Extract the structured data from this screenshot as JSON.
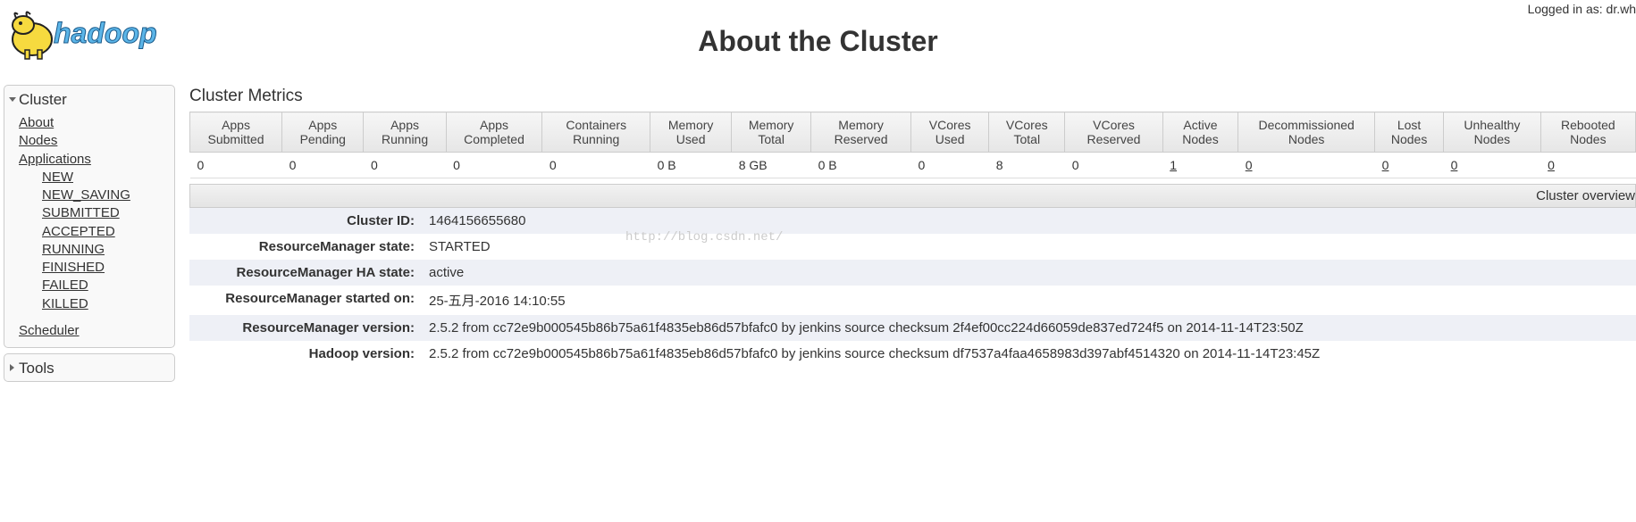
{
  "login_prefix": "Logged in as: ",
  "login_user": "dr.wh",
  "page_title": "About the Cluster",
  "sidebar": {
    "cluster_title": "Cluster",
    "tools_title": "Tools",
    "links": {
      "about": "About",
      "nodes": "Nodes",
      "applications": "Applications",
      "scheduler": "Scheduler"
    },
    "app_states": [
      "NEW",
      "NEW_SAVING",
      "SUBMITTED",
      "ACCEPTED",
      "RUNNING",
      "FINISHED",
      "FAILED",
      "KILLED"
    ]
  },
  "metrics": {
    "title": "Cluster Metrics",
    "headers": [
      "Apps Submitted",
      "Apps Pending",
      "Apps Running",
      "Apps Completed",
      "Containers Running",
      "Memory Used",
      "Memory Total",
      "Memory Reserved",
      "VCores Used",
      "VCores Total",
      "VCores Reserved",
      "Active Nodes",
      "Decommissioned Nodes",
      "Lost Nodes",
      "Unhealthy Nodes",
      "Rebooted Nodes"
    ],
    "values": [
      "0",
      "0",
      "0",
      "0",
      "0",
      "0 B",
      "8 GB",
      "0 B",
      "0",
      "8",
      "0",
      "1",
      "0",
      "0",
      "0",
      "0"
    ],
    "link_cols": [
      11,
      12,
      13,
      14,
      15
    ]
  },
  "overview_label": "Cluster overview",
  "overview": [
    {
      "label": "Cluster ID:",
      "value": "1464156655680"
    },
    {
      "label": "ResourceManager state:",
      "value": "STARTED"
    },
    {
      "label": "ResourceManager HA state:",
      "value": "active"
    },
    {
      "label": "ResourceManager started on:",
      "value": "25-五月-2016 14:10:55"
    },
    {
      "label": "ResourceManager version:",
      "value": "2.5.2 from cc72e9b000545b86b75a61f4835eb86d57bfafc0 by jenkins source checksum 2f4ef00cc224d66059de837ed724f5 on 2014-11-14T23:50Z"
    },
    {
      "label": "Hadoop version:",
      "value": "2.5.2 from cc72e9b000545b86b75a61f4835eb86d57bfafc0 by jenkins source checksum df7537a4faa4658983d397abf4514320 on 2014-11-14T23:45Z"
    }
  ],
  "watermark": "http://blog.csdn.net/"
}
